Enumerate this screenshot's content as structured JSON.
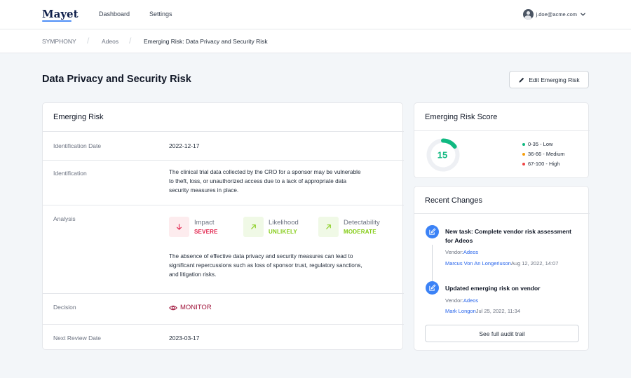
{
  "app": {
    "logo": "Mayet",
    "nav": [
      "Dashboard",
      "Settings"
    ],
    "user_email": "j.doe@acme.com"
  },
  "breadcrumb": [
    "SYMPHONY",
    "Adeos",
    "Emerging Risk: Data Privacy and Security Risk"
  ],
  "page": {
    "title": "Data Privacy and Security Risk",
    "edit_button": "Edit Emerging Risk"
  },
  "risk_card": {
    "title": "Emerging Risk",
    "identification_date_label": "Identification Date",
    "identification_date": "2022-12-17",
    "identification_label": "Identification",
    "identification_lines": [
      "The clinical trial data collected by the CRO for a sponsor may be vulnerable",
      "to theft, loss, or unauthorized access due to a lack of appropriate data",
      "security measures in place."
    ],
    "analysis_label": "Analysis",
    "metrics": [
      {
        "name": "Impact",
        "value": "SEVERE",
        "icon": "arrow-down-icon",
        "color": "#e11d48",
        "bg": "#fdecee"
      },
      {
        "name": "Likelihood",
        "value": "UNLIKELY",
        "icon": "arrow-up-right-icon",
        "color": "#84cc16",
        "bg": "#f0f9e6"
      },
      {
        "name": "Detectability",
        "value": "MODERATE",
        "icon": "arrow-up-right-icon",
        "color": "#84cc16",
        "bg": "#f0f9e6"
      }
    ],
    "analysis_lines": [
      "The absence of effective data privacy and security measures can lead to",
      "significant repercussions such as loss of sponsor trust, regulatory sanctions,",
      "and litigation risks."
    ],
    "decision_label": "Decision",
    "decision": "MONITOR",
    "next_review_label": "Next Review Date",
    "next_review": "2023-03-17"
  },
  "score_card": {
    "title": "Emerging Risk Score",
    "score": "15",
    "score_fraction": 0.15,
    "score_color": "#10b981",
    "legend": [
      {
        "label": "0-35 - Low",
        "color": "#10b981"
      },
      {
        "label": "36-66 - Medium",
        "color": "#f59e0b"
      },
      {
        "label": "67-100 - High",
        "color": "#ef4444"
      }
    ]
  },
  "changes": {
    "title": "Recent Changes",
    "items": [
      {
        "title_lines": [
          "New task: Complete vendor risk assessment",
          "for Adeos"
        ],
        "vendor_label": "Vendor:",
        "vendor": "Adeos",
        "user": "Marcus Von An Longeriuson",
        "date": "Aug 12, 2022, 14:07",
        "icon": "edit-icon"
      },
      {
        "title_lines": [
          "Updated emerging risk on vendor"
        ],
        "vendor_label": "Vendor:",
        "vendor": "Adeos",
        "user": "Mark Longon",
        "date": "Jul 25, 2022, 11:34",
        "icon": "edit-icon"
      }
    ],
    "audit_button": "See full audit trail"
  }
}
